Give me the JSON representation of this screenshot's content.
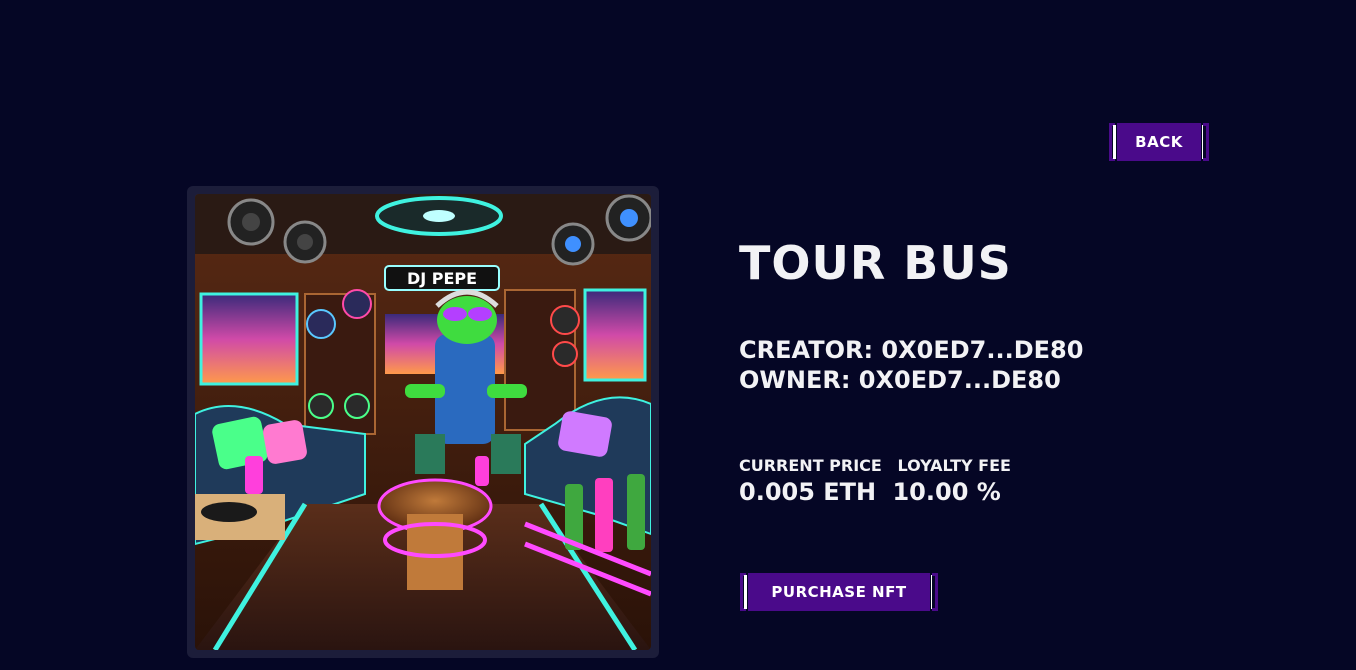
{
  "nav": {
    "back_label": "BACK"
  },
  "nft": {
    "title": "TOUR BUS",
    "creator_label": "CREATOR:",
    "creator": "0X0ED7...DE80",
    "owner_label": "OWNER:",
    "owner": "0X0ED7...DE80",
    "price_label": "CURRENT PRICE",
    "fee_label": "LOYALTY FEE",
    "price": "0.005 ETH",
    "fee": "10.00 %",
    "image_sign_text": "DJ PEPE"
  },
  "actions": {
    "purchase_label": "PURCHASE NFT"
  },
  "colors": {
    "background": "#050625",
    "button": "#4a0a8a",
    "frame": "#1c1d3a",
    "text": "#f2f2f5"
  }
}
